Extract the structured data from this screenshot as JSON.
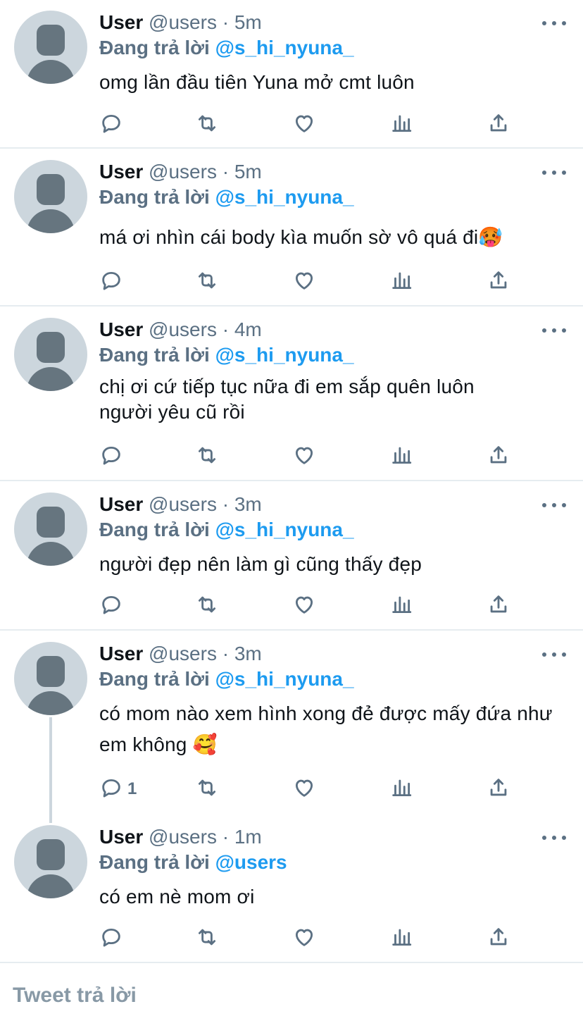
{
  "tweets": [
    {
      "name": "User",
      "handle": "@users",
      "dot": "·",
      "time": "5m",
      "reply_prefix": "Đang trả lời",
      "reply_to": "@s_hi_nyuna_",
      "text": "omg lần đầu tiên Yuna mở cmt luôn",
      "reply_count": ""
    },
    {
      "name": "User",
      "handle": "@users",
      "dot": "·",
      "time": "5m",
      "reply_prefix": "Đang trả lời",
      "reply_to": "@s_hi_nyuna_",
      "text": "má ơi nhìn cái body kìa muốn sờ vô quá đi🥵",
      "reply_count": ""
    },
    {
      "name": "User",
      "handle": "@users",
      "dot": "·",
      "time": "4m",
      "reply_prefix": "Đang trả lời",
      "reply_to": "@s_hi_nyuna_",
      "text": "chị ơi cứ tiếp tục nữa đi em sắp quên luôn người yêu cũ rồi",
      "reply_count": ""
    },
    {
      "name": "User",
      "handle": "@users",
      "dot": "·",
      "time": "3m",
      "reply_prefix": "Đang trả lời",
      "reply_to": "@s_hi_nyuna_",
      "text": "người đẹp nên làm gì cũng thấy đẹp",
      "reply_count": ""
    },
    {
      "name": "User",
      "handle": "@users",
      "dot": "·",
      "time": "3m",
      "reply_prefix": "Đang trả lời",
      "reply_to": "@s_hi_nyuna_",
      "text": "có mom nào xem hình xong đẻ được mấy đứa như em không 🥰",
      "reply_count": "1"
    },
    {
      "name": "User",
      "handle": "@users",
      "dot": "·",
      "time": "1m",
      "reply_prefix": "Đang trả lời",
      "reply_to": "@users",
      "text": "có em nè mom ơi",
      "reply_count": ""
    }
  ],
  "icons": {
    "avatar": "default-avatar-icon",
    "more": "more-options-icon",
    "reply": "reply-icon",
    "retweet": "retweet-icon",
    "like": "like-icon",
    "analytics": "analytics-icon",
    "share": "share-icon"
  },
  "colors": {
    "link": "#1d9bf0",
    "muted": "#5b7083",
    "avatar_bg": "#ccd6dd"
  },
  "composer": {
    "placeholder": "Tweet trả lời"
  }
}
